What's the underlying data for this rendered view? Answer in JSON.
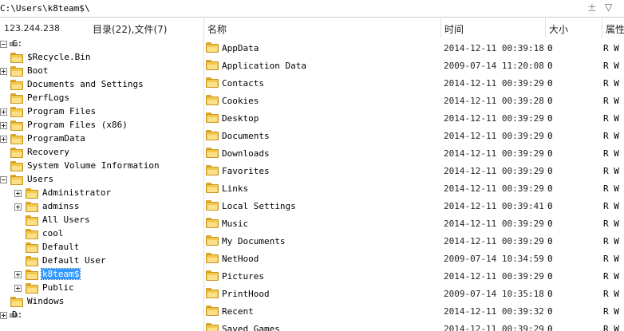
{
  "pathbar": {
    "path": "C:\\Users\\k8team$\\",
    "plus_glyph": "±",
    "dropdown_glyph": "▽"
  },
  "left": {
    "ip": "123.244.238",
    "counts": "目录(22),文件(7)",
    "tree": [
      {
        "label": "C:",
        "type": "drive",
        "level": 0,
        "expander": "minus"
      },
      {
        "label": "$Recycle.Bin",
        "type": "folder",
        "level": 1,
        "expander": ""
      },
      {
        "label": "Boot",
        "type": "folder",
        "level": 1,
        "expander": "plus"
      },
      {
        "label": "Documents and Settings",
        "type": "folder",
        "level": 1,
        "expander": ""
      },
      {
        "label": "PerfLogs",
        "type": "folder",
        "level": 1,
        "expander": ""
      },
      {
        "label": "Program Files",
        "type": "folder",
        "level": 1,
        "expander": "plus"
      },
      {
        "label": "Program Files (x86)",
        "type": "folder",
        "level": 1,
        "expander": "plus"
      },
      {
        "label": "ProgramData",
        "type": "folder",
        "level": 1,
        "expander": "plus"
      },
      {
        "label": "Recovery",
        "type": "folder",
        "level": 1,
        "expander": ""
      },
      {
        "label": "System Volume Information",
        "type": "folder",
        "level": 1,
        "expander": ""
      },
      {
        "label": "Users",
        "type": "folder",
        "level": 1,
        "expander": "minus"
      },
      {
        "label": "Administrator",
        "type": "folder",
        "level": 2,
        "expander": "plus"
      },
      {
        "label": "adminss",
        "type": "folder",
        "level": 2,
        "expander": "plus"
      },
      {
        "label": "All Users",
        "type": "folder",
        "level": 2,
        "expander": ""
      },
      {
        "label": "cool",
        "type": "folder",
        "level": 2,
        "expander": ""
      },
      {
        "label": "Default",
        "type": "folder",
        "level": 2,
        "expander": ""
      },
      {
        "label": "Default User",
        "type": "folder",
        "level": 2,
        "expander": ""
      },
      {
        "label": "k8team$",
        "type": "folder",
        "level": 2,
        "expander": "plus",
        "selected": true
      },
      {
        "label": "Public",
        "type": "folder",
        "level": 2,
        "expander": "plus"
      },
      {
        "label": "Windows",
        "type": "folder",
        "level": 1,
        "expander": ""
      },
      {
        "label": "D:",
        "type": "drive",
        "level": 0,
        "expander": "plus"
      }
    ]
  },
  "right": {
    "columns": [
      "名称",
      "时间",
      "大小",
      "属性"
    ],
    "files": [
      {
        "name": "AppData",
        "time": "2014-12-11 00:39:18",
        "size": "0",
        "attr": "R W"
      },
      {
        "name": "Application Data",
        "time": "2009-07-14 11:20:08",
        "size": "0",
        "attr": "R W"
      },
      {
        "name": "Contacts",
        "time": "2014-12-11 00:39:29",
        "size": "0",
        "attr": "R W"
      },
      {
        "name": "Cookies",
        "time": "2014-12-11 00:39:28",
        "size": "0",
        "attr": "R W"
      },
      {
        "name": "Desktop",
        "time": "2014-12-11 00:39:29",
        "size": "0",
        "attr": "R W"
      },
      {
        "name": "Documents",
        "time": "2014-12-11 00:39:29",
        "size": "0",
        "attr": "R W"
      },
      {
        "name": "Downloads",
        "time": "2014-12-11 00:39:29",
        "size": "0",
        "attr": "R W"
      },
      {
        "name": "Favorites",
        "time": "2014-12-11 00:39:29",
        "size": "0",
        "attr": "R W"
      },
      {
        "name": "Links",
        "time": "2014-12-11 00:39:29",
        "size": "0",
        "attr": "R W"
      },
      {
        "name": "Local Settings",
        "time": "2014-12-11 00:39:41",
        "size": "0",
        "attr": "R W"
      },
      {
        "name": "Music",
        "time": "2014-12-11 00:39:29",
        "size": "0",
        "attr": "R W"
      },
      {
        "name": "My Documents",
        "time": "2014-12-11 00:39:29",
        "size": "0",
        "attr": "R W"
      },
      {
        "name": "NetHood",
        "time": "2009-07-14 10:34:59",
        "size": "0",
        "attr": "R W"
      },
      {
        "name": "Pictures",
        "time": "2014-12-11 00:39:29",
        "size": "0",
        "attr": "R W"
      },
      {
        "name": "PrintHood",
        "time": "2009-07-14 10:35:18",
        "size": "0",
        "attr": "R W"
      },
      {
        "name": "Recent",
        "time": "2014-12-11 00:39:32",
        "size": "0",
        "attr": "R W"
      },
      {
        "name": "Saved Games",
        "time": "2014-12-11 00:39:29",
        "size": "0",
        "attr": "R W"
      }
    ]
  },
  "colors": {
    "selection": "#3399ff",
    "folder": "#f2c94c"
  }
}
